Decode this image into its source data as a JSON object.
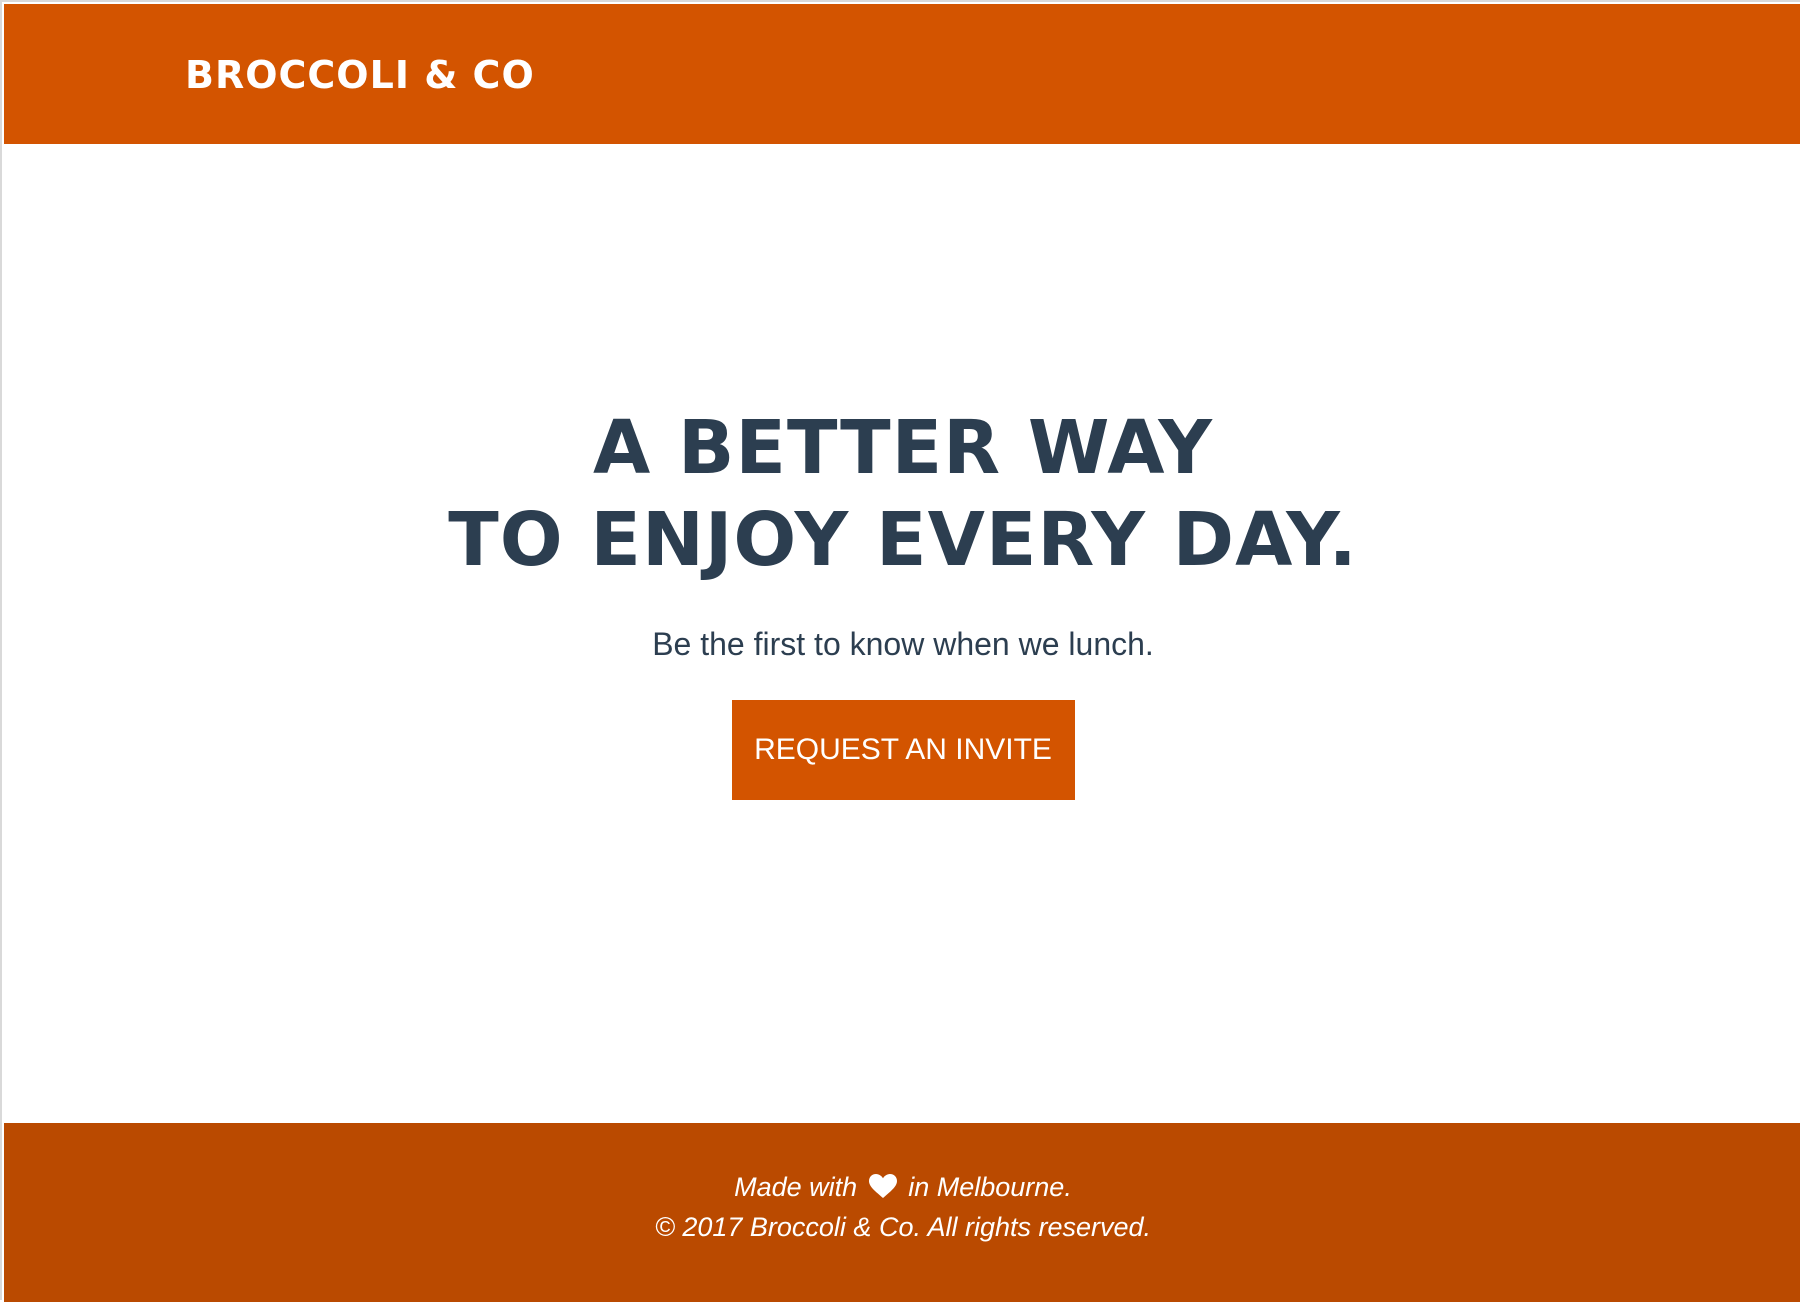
{
  "header": {
    "brand": "BROCCOLI & CO"
  },
  "hero": {
    "headline_line1": "A BETTER WAY",
    "headline_line2": "TO ENJOY EVERY DAY.",
    "subline": "Be the first to know when we lunch.",
    "cta_label": "REQUEST AN INVITE"
  },
  "footer": {
    "made_prefix": "Made with",
    "heart_icon": "heart-icon",
    "made_suffix": "in Melbourne.",
    "copyright": "© 2017 Broccoli & Co. All rights reserved."
  },
  "colors": {
    "brand_orange": "#d35400",
    "footer_orange": "#ba4a00",
    "text_dark": "#2c3e50",
    "white": "#ffffff"
  }
}
